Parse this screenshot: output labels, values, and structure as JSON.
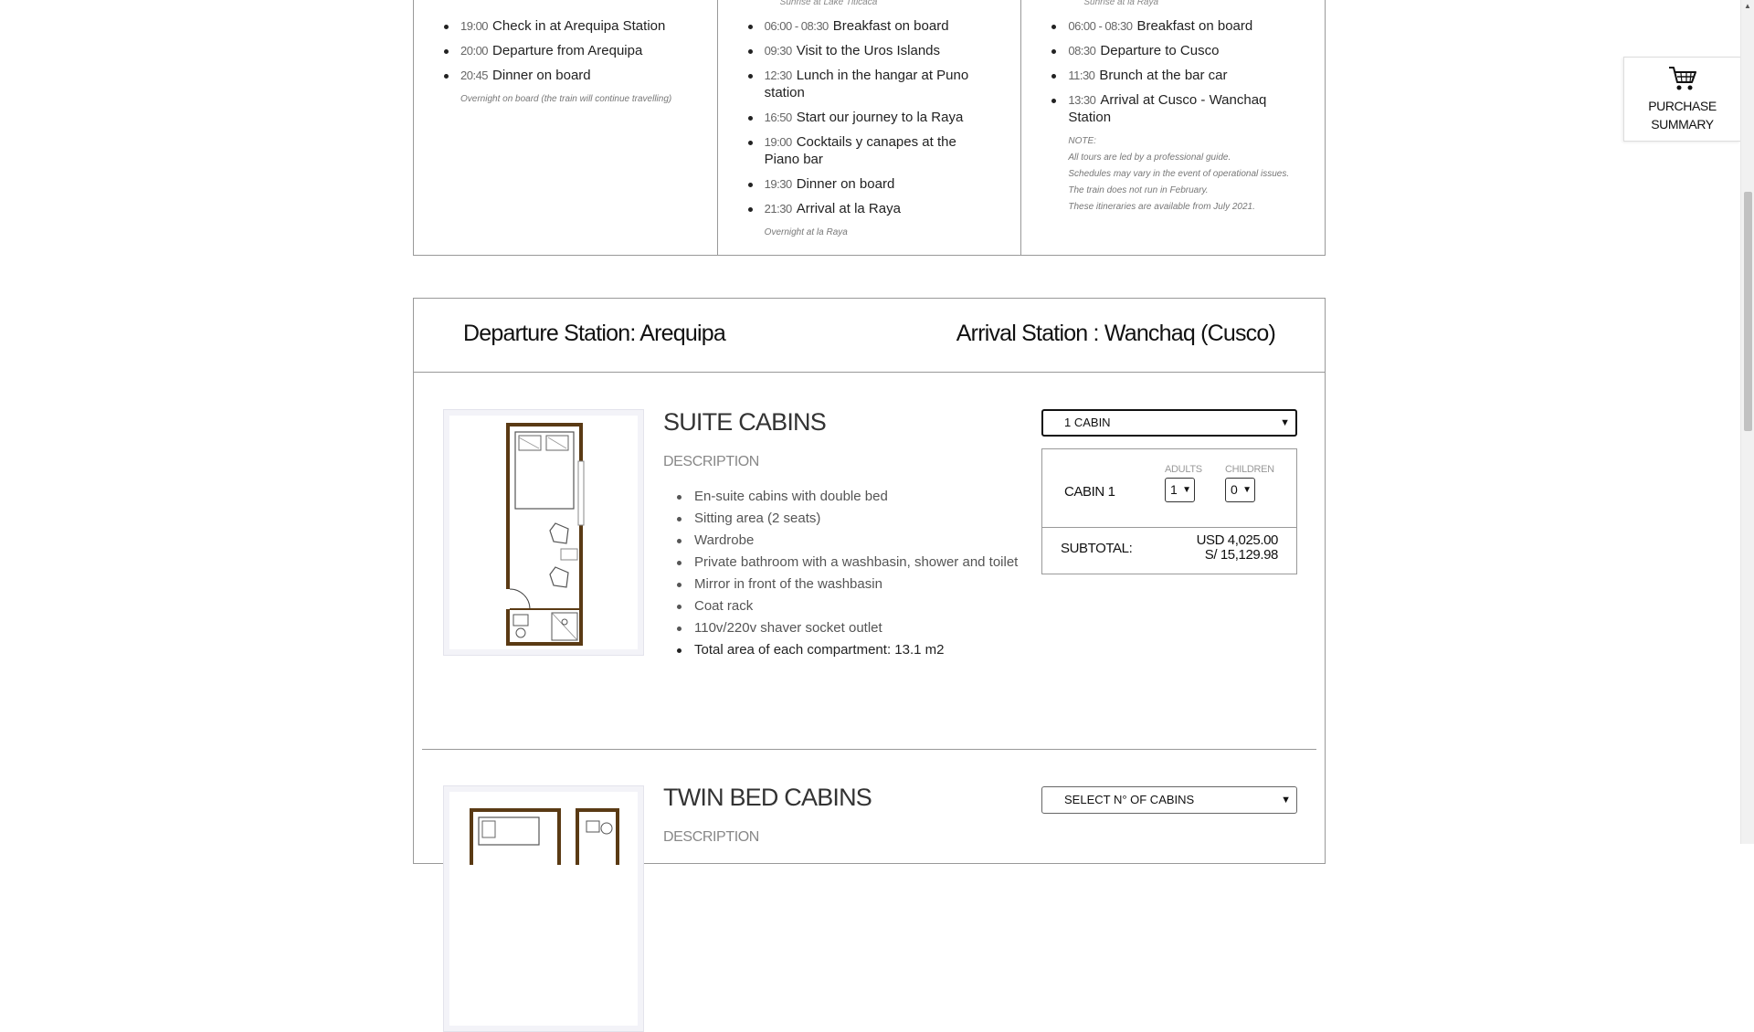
{
  "itinerary": {
    "columns": [
      {
        "sunrise": "",
        "items": [
          {
            "time": "19:00",
            "text": "Check in at Arequipa Station"
          },
          {
            "time": "20:00",
            "text": "Departure from Arequipa"
          },
          {
            "time": "20:45",
            "text": "Dinner on board"
          }
        ],
        "note_title": "",
        "notes": [
          "Overnight on board (the train will continue travelling)"
        ]
      },
      {
        "sunrise": "Sunrise at Lake Titicaca",
        "items": [
          {
            "time": "06:00 - 08:30",
            "text": "Breakfast on board"
          },
          {
            "time": "09:30",
            "text": "Visit to the Uros Islands"
          },
          {
            "time": "12:30",
            "text": "Lunch in the hangar at Puno station"
          },
          {
            "time": "16:50",
            "text": "Start our journey to la Raya"
          },
          {
            "time": "19:00",
            "text": "Cocktails y canapes at the Piano bar"
          },
          {
            "time": "19:30",
            "text": "Dinner on board"
          },
          {
            "time": "21:30",
            "text": "Arrival at la Raya"
          }
        ],
        "note_title": "",
        "notes": [
          "Overnight at la Raya"
        ]
      },
      {
        "sunrise": "Sunrise at la Raya",
        "items": [
          {
            "time": "06:00 - 08:30",
            "text": "Breakfast on board"
          },
          {
            "time": "08:30",
            "text": "Departure to Cusco"
          },
          {
            "time": "11:30",
            "text": "Brunch at the bar car"
          },
          {
            "time": "13:30",
            "text": "Arrival at Cusco - Wanchaq Station"
          }
        ],
        "note_title": "NOTE:",
        "notes": [
          "All tours are led by a professional guide.",
          "Schedules may vary in the event of operational issues.",
          "The train does not run in February.",
          "These itineraries are available from July 2021."
        ]
      }
    ]
  },
  "purchase_summary": {
    "icon": "cart-icon",
    "label_line1": "PURCHASE",
    "label_line2": "SUMMARY"
  },
  "booking": {
    "departure": "Departure Station: Arequipa",
    "arrival": "Arrival Station : Wanchaq (Cusco)",
    "cabins": [
      {
        "title": "SUITE CABINS",
        "description_heading": "DESCRIPTION",
        "features": [
          "En-suite cabins with double bed",
          "Sitting area (2 seats)",
          "Wardrobe",
          "Private bathroom with a washbasin, shower and toilet",
          "Mirror in front of the washbasin",
          "Coat rack",
          "110v/220v shaver socket outlet"
        ],
        "area": "Total area of each compartment: 13.1 m2",
        "select_value": "1 CABIN",
        "cabin_label": "CABIN 1",
        "adults_label": "ADULTS",
        "children_label": "CHILDREN",
        "adults_value": "1",
        "children_value": "0",
        "subtotal_label": "SUBTOTAL:",
        "subtotal_usd": "USD 4,025.00",
        "subtotal_pen": "S/ 15,129.98"
      },
      {
        "title": "TWIN BED CABINS",
        "description_heading": "DESCRIPTION",
        "select_value": "SELECT N° OF CABINS"
      }
    ]
  },
  "colors": {
    "border": "#999999",
    "cabin_wall": "#5a3a14",
    "text": "#222222"
  }
}
